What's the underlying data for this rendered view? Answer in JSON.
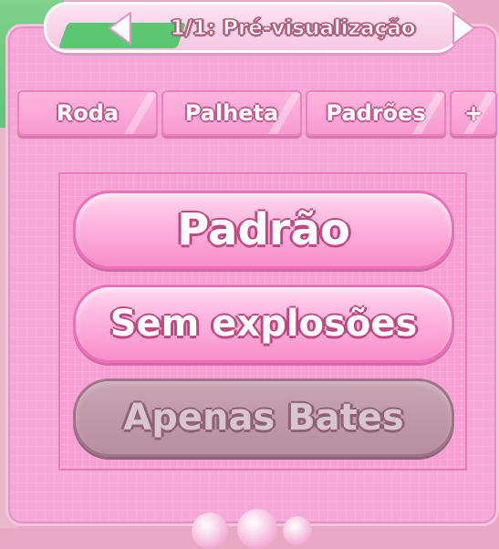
{
  "header": {
    "title": "1/1: Pré-visualização",
    "prev_icon": "triangle-left-icon",
    "next_icon": "triangle-right-icon"
  },
  "tabs": [
    {
      "label": "Roda"
    },
    {
      "label": "Palheta"
    },
    {
      "label": "Padrões"
    },
    {
      "label": "+"
    }
  ],
  "options": [
    {
      "label": "Padrão",
      "state": "enabled"
    },
    {
      "label": "Sem explosões",
      "state": "enabled"
    },
    {
      "label": "Apenas Bates",
      "state": "disabled"
    }
  ],
  "colors": {
    "panel": "#f6a8d6",
    "accent_text_outline": "#c0487f",
    "disabled_button": "#b68ea0",
    "background_green": "#62c37a"
  }
}
